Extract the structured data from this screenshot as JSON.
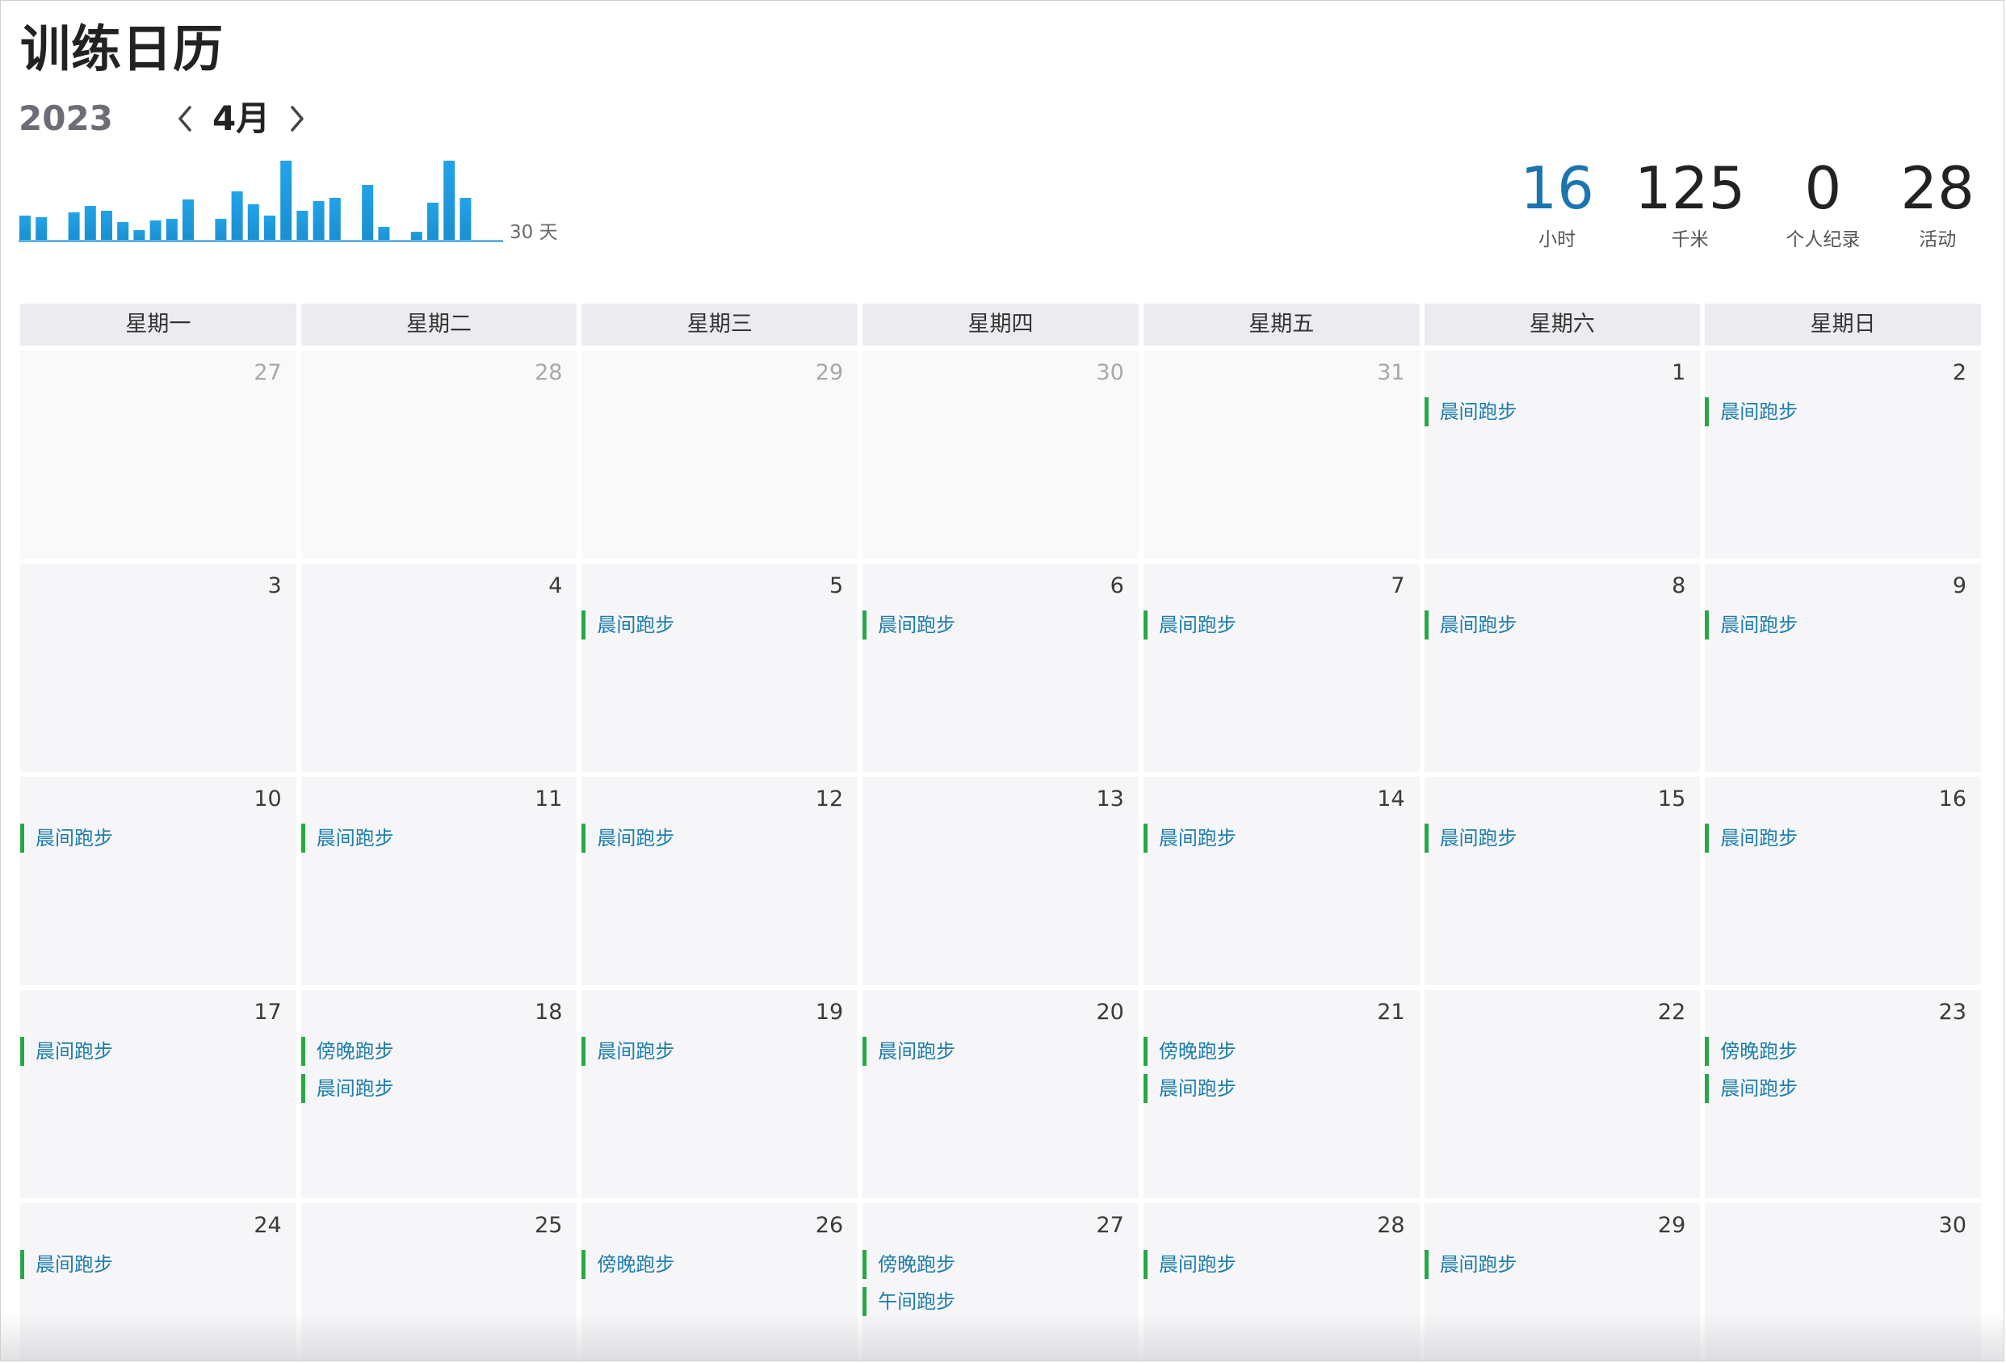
{
  "title": "训练日历",
  "year": "2023",
  "month": "4月",
  "mini_chart": {
    "label": "30 天",
    "bar_color": "#1a8fd0",
    "values": [
      0.3,
      0.28,
      0,
      0.34,
      0.42,
      0.36,
      0.22,
      0.12,
      0.24,
      0.26,
      0.5,
      0,
      0.26,
      0.6,
      0.44,
      0.3,
      0.98,
      0.36,
      0.48,
      0.52,
      0,
      0.68,
      0.16,
      0,
      0.1,
      0.46,
      0.98,
      0.52
    ]
  },
  "stats": [
    {
      "value": "16",
      "label": "小时",
      "accent": true
    },
    {
      "value": "125",
      "label": "千米",
      "accent": false
    },
    {
      "value": "0",
      "label": "个人纪录",
      "accent": false
    },
    {
      "value": "28",
      "label": "活动",
      "accent": false
    }
  ],
  "weekdays": [
    "星期一",
    "星期二",
    "星期三",
    "星期四",
    "星期五",
    "星期六",
    "星期日"
  ],
  "days": [
    {
      "day": "27",
      "other": true,
      "activities": []
    },
    {
      "day": "28",
      "other": true,
      "activities": []
    },
    {
      "day": "29",
      "other": true,
      "activities": []
    },
    {
      "day": "30",
      "other": true,
      "activities": []
    },
    {
      "day": "31",
      "other": true,
      "activities": []
    },
    {
      "day": "1",
      "other": false,
      "activities": [
        "晨间跑步"
      ]
    },
    {
      "day": "2",
      "other": false,
      "activities": [
        "晨间跑步"
      ]
    },
    {
      "day": "3",
      "other": false,
      "activities": []
    },
    {
      "day": "4",
      "other": false,
      "activities": []
    },
    {
      "day": "5",
      "other": false,
      "activities": [
        "晨间跑步"
      ]
    },
    {
      "day": "6",
      "other": false,
      "activities": [
        "晨间跑步"
      ]
    },
    {
      "day": "7",
      "other": false,
      "activities": [
        "晨间跑步"
      ]
    },
    {
      "day": "8",
      "other": false,
      "activities": [
        "晨间跑步"
      ]
    },
    {
      "day": "9",
      "other": false,
      "activities": [
        "晨间跑步"
      ]
    },
    {
      "day": "10",
      "other": false,
      "activities": [
        "晨间跑步"
      ]
    },
    {
      "day": "11",
      "other": false,
      "activities": [
        "晨间跑步"
      ]
    },
    {
      "day": "12",
      "other": false,
      "activities": [
        "晨间跑步"
      ]
    },
    {
      "day": "13",
      "other": false,
      "activities": []
    },
    {
      "day": "14",
      "other": false,
      "activities": [
        "晨间跑步"
      ]
    },
    {
      "day": "15",
      "other": false,
      "activities": [
        "晨间跑步"
      ]
    },
    {
      "day": "16",
      "other": false,
      "activities": [
        "晨间跑步"
      ]
    },
    {
      "day": "17",
      "other": false,
      "activities": [
        "晨间跑步"
      ]
    },
    {
      "day": "18",
      "other": false,
      "activities": [
        "傍晚跑步",
        "晨间跑步"
      ]
    },
    {
      "day": "19",
      "other": false,
      "activities": [
        "晨间跑步"
      ]
    },
    {
      "day": "20",
      "other": false,
      "activities": [
        "晨间跑步"
      ]
    },
    {
      "day": "21",
      "other": false,
      "activities": [
        "傍晚跑步",
        "晨间跑步"
      ]
    },
    {
      "day": "22",
      "other": false,
      "activities": []
    },
    {
      "day": "23",
      "other": false,
      "activities": [
        "傍晚跑步",
        "晨间跑步"
      ]
    },
    {
      "day": "24",
      "other": false,
      "activities": [
        "晨间跑步"
      ]
    },
    {
      "day": "25",
      "other": false,
      "activities": []
    },
    {
      "day": "26",
      "other": false,
      "activities": [
        "傍晚跑步"
      ]
    },
    {
      "day": "27",
      "other": false,
      "activities": [
        "傍晚跑步",
        "午间跑步"
      ]
    },
    {
      "day": "28",
      "other": false,
      "activities": [
        "晨间跑步"
      ]
    },
    {
      "day": "29",
      "other": false,
      "activities": [
        "晨间跑步"
      ]
    },
    {
      "day": "30",
      "other": false,
      "activities": []
    }
  ]
}
